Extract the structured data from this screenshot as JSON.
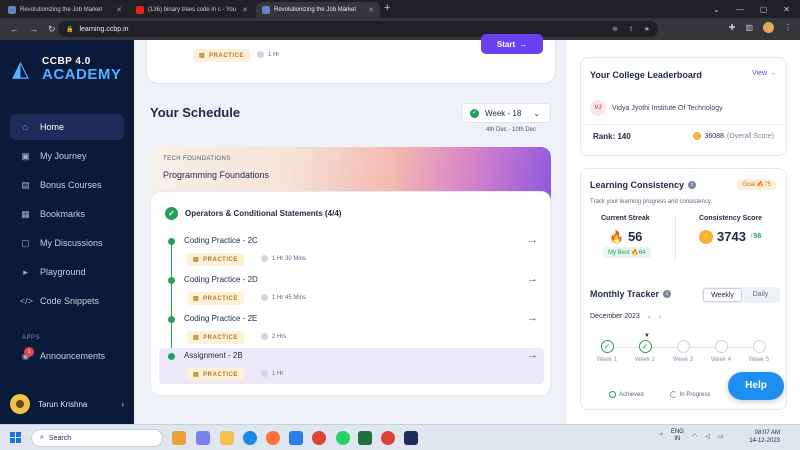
{
  "browser": {
    "tabs": [
      {
        "label": "Revolutionizing the Job Market",
        "active": false
      },
      {
        "label": "(136) binary trees code in c - You",
        "active": false
      },
      {
        "label": "Revolutionizing the Job Market",
        "active": true
      }
    ],
    "url": "learning.ccbp.in"
  },
  "sidebar": {
    "logo_line1": "CCBP 4.0",
    "logo_line2": "ACADEMY",
    "items": [
      {
        "label": "Home",
        "active": true
      },
      {
        "label": "My Journey"
      },
      {
        "label": "Bonus Courses"
      },
      {
        "label": "Bookmarks"
      },
      {
        "label": "My Discussions"
      },
      {
        "label": "Playground"
      },
      {
        "label": "Code Snippets"
      }
    ],
    "apps_label": "APPS",
    "announcements_label": "Announcements",
    "announcement_badge": "1",
    "user_name": "Tarun Krishna"
  },
  "top_card": {
    "chip": "PRACTICE",
    "time": "1 Hr",
    "start_label": "Start"
  },
  "schedule": {
    "title": "Your Schedule",
    "week": "Week - 18",
    "range": "4th Dec - 10th Dec",
    "banner_label": "TECH FOUNDATIONS",
    "banner_title": "Programming Foundations",
    "module_title": "Operators & Conditional Statements (4/4)",
    "items": [
      {
        "name": "Coding Practice - 2C",
        "chip": "PRACTICE",
        "time": "1 Hr 30 Mins"
      },
      {
        "name": "Coding Practice - 2D",
        "chip": "PRACTICE",
        "time": "1 Hr 45 Mins"
      },
      {
        "name": "Coding Practice - 2E",
        "chip": "PRACTICE",
        "time": "2 Hrs"
      },
      {
        "name": "Assignment - 2B",
        "chip": "PRACTICE",
        "time": "1 Hr"
      }
    ]
  },
  "leaderboard": {
    "title": "Your College Leaderboard",
    "view_label": "View",
    "college_initials": "VJ",
    "college_name": "Vidya Jyothi Institute Of Technology",
    "rank": "Rank: 140",
    "score": "36088",
    "score_suffix": "(Overall Score)"
  },
  "consistency": {
    "title": "Learning Consistency",
    "goal": "Goal",
    "goal_value": "75",
    "subtitle": "Track your learning progress and consistency.",
    "streak_label": "Current Streak",
    "streak_value": "56",
    "my_best": "My Best",
    "my_best_value": "64",
    "score_label": "Consistency Score",
    "score_value": "3743",
    "score_delta": "56",
    "monthly_title": "Monthly Tracker",
    "toggle_weekly": "Weekly",
    "toggle_daily": "Daily",
    "month": "December 2023",
    "weeks": [
      {
        "label": "Week 1",
        "done": true
      },
      {
        "label": "Week 2",
        "done": true
      },
      {
        "label": "Week 3",
        "done": false
      },
      {
        "label": "Week 4",
        "done": false
      },
      {
        "label": "Week 5",
        "done": false
      }
    ],
    "legend_achieved": "Achieved",
    "legend_progress": "In Progress"
  },
  "help_label": "Help",
  "taskbar": {
    "search": "Search",
    "lang1": "ENG",
    "lang2": "IN",
    "time": "08:07 AM",
    "date": "14-12-2023"
  },
  "colors": {
    "accent": "#6b3ff0",
    "sidebar": "#0b1a3a",
    "success": "#22a05a",
    "help": "#1f8ef1"
  }
}
